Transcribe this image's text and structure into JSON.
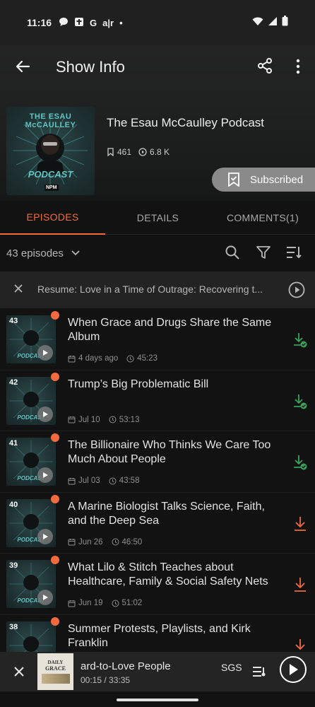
{
  "status_bar": {
    "time": "11:16",
    "icons": [
      "chat-bubble-icon",
      "bible-app-icon",
      "google-icon",
      "air-app-icon",
      "dot-icon"
    ],
    "right_icons": [
      "wifi-icon",
      "signal-icon",
      "battery-icon"
    ],
    "g_label": "G",
    "air_label": "a|r",
    "dot_label": "•"
  },
  "toolbar": {
    "title": "Show Info"
  },
  "podcast": {
    "title": "The Esau McCaulley Podcast",
    "subscribers": "461",
    "plays": "6.8 K",
    "subscribe_label": "Subscribed",
    "cover_top_text": "THE ESAU McCAULLEY",
    "cover_bottom_text": "PODCAST",
    "cover_badge": "NPM"
  },
  "tabs": [
    {
      "label": "EPISODES",
      "active": true
    },
    {
      "label": "DETAILS",
      "active": false
    },
    {
      "label": "COMMENTS(1)",
      "active": false
    }
  ],
  "filter": {
    "episode_count": "43 episodes"
  },
  "resume": {
    "text": "Resume: Love in a Time of Outrage: Recovering t..."
  },
  "episodes": [
    {
      "number": "43",
      "title": "When Grace and Drugs Share the Same Album",
      "date": "4 days ago",
      "duration": "45:23",
      "downloaded": true
    },
    {
      "number": "42",
      "title": "Trump’s Big Problematic Bill",
      "date": "Jul 10",
      "duration": "53:13",
      "downloaded": true
    },
    {
      "number": "41",
      "title": "The Billionaire Who Thinks We Care Too Much About People",
      "date": "Jul 03",
      "duration": "43:58",
      "downloaded": true
    },
    {
      "number": "40",
      "title": "A Marine Biologist Talks Science, Faith, and the Deep Sea",
      "date": "Jun 26",
      "duration": "46:50",
      "downloaded": false
    },
    {
      "number": "39",
      "title": "What Lilo & Stitch Teaches about Healthcare, Family & Social Safety Nets",
      "date": "Jun 19",
      "duration": "51:02",
      "downloaded": false
    },
    {
      "number": "38",
      "title": "Summer Protests, Playlists, and Kirk Franklin",
      "date": "",
      "duration": "",
      "downloaded": false
    }
  ],
  "mini_player": {
    "title": "ard-to-Love People",
    "time": "00:15 / 33:35",
    "speed": "SGS",
    "art_line1": "DAILY",
    "art_line2": "GRACE"
  },
  "colors": {
    "accent": "#f26a3d",
    "downloaded": "#3aa05a",
    "background": "#121212"
  }
}
